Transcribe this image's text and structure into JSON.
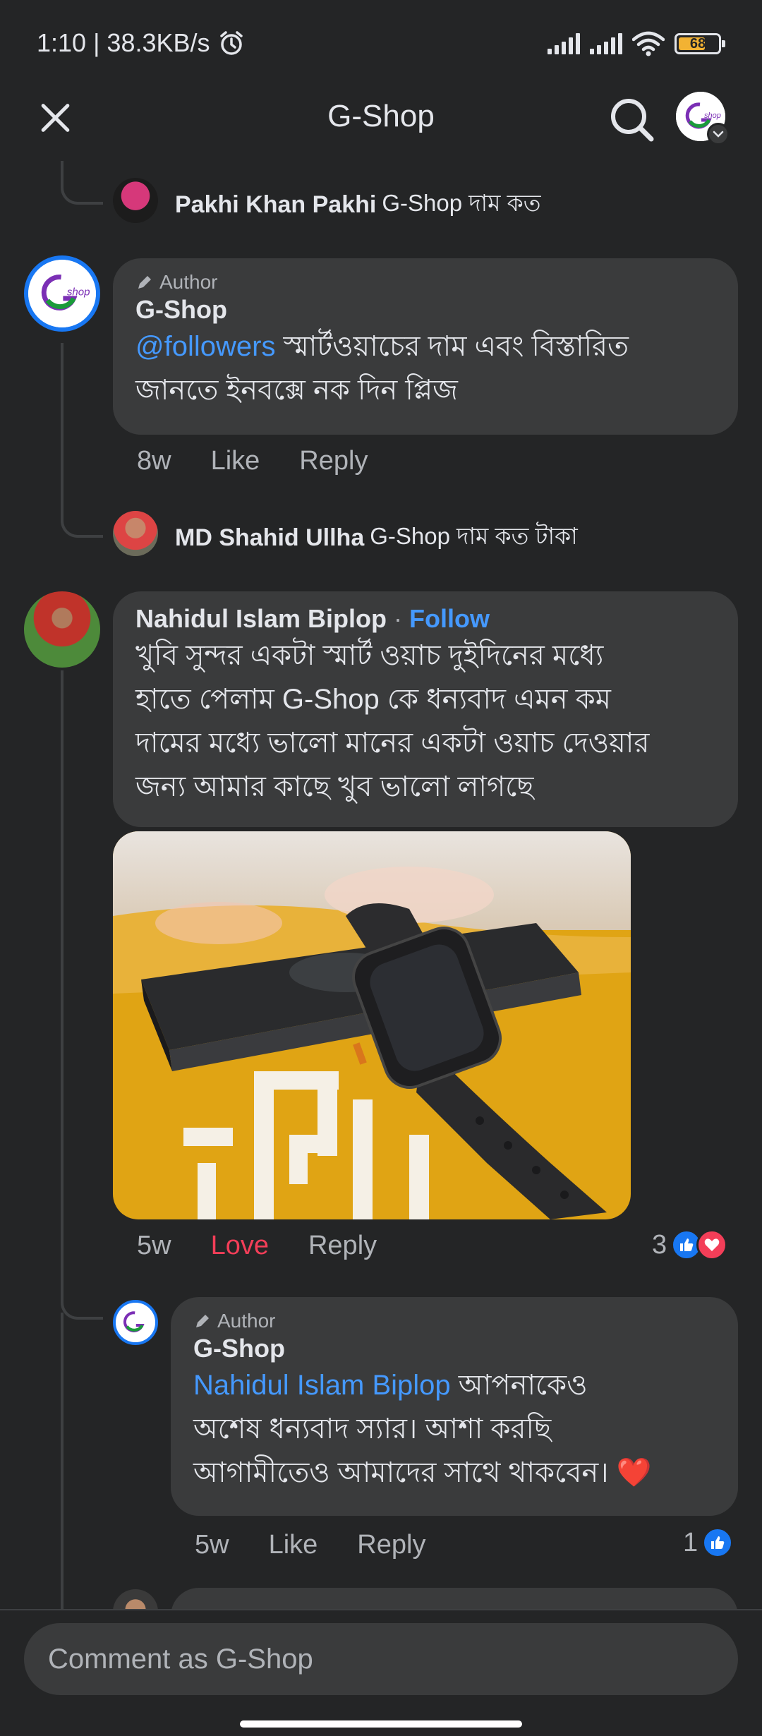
{
  "status": {
    "time_speed": "1:10 | 38.3KB/s",
    "battery": "68"
  },
  "header": {
    "title": "G-Shop",
    "logo_text": "shop"
  },
  "comments": [
    {
      "name": "Pakhi Khan Pakhi",
      "text": "G-Shop দাম কত"
    },
    {
      "author_label": "Author",
      "name": "G-Shop",
      "mention": "@followers",
      "text_line1": " স্মার্টওয়াচের দাম এবং বিস্তারিত",
      "text_line2": "জানতে ইনবক্সে নক দিন প্লিজ",
      "time": "8w",
      "like": "Like",
      "reply": "Reply"
    },
    {
      "name": "MD Shahid Ullha",
      "text": "G-Shop দাম কত টাকা"
    },
    {
      "name": "Nahidul Islam Biplop",
      "sep": " · ",
      "follow": "Follow",
      "text_lines": [
        "খুবি সুন্দর একটা স্মার্ট ওয়াচ দুইদিনের মধ্যে",
        "হাতে পেলাম G-Shop কে ধন্যবাদ এমন কম",
        "দামের মধ্যে ভালো মানের একটা ওয়াচ দেওয়ার",
        "জন্য আমার কাছে খুব ভালো লাগছে"
      ],
      "time": "5w",
      "love": "Love",
      "reply": "Reply",
      "reaction_count": "3"
    },
    {
      "author_label": "Author",
      "name": "G-Shop",
      "mention": "Nahidul Islam Biplop",
      "text_line1": " আপনাকেও",
      "text_line2": "অশেষ ধন্যবাদ স্যার। আশা করছি",
      "text_line3": "আগামীতেও আমাদের সাথে থাকবেন। ",
      "emoji": "❤️",
      "time": "5w",
      "like": "Like",
      "reply": "Reply",
      "reaction_count": "1"
    }
  ],
  "composer": {
    "placeholder": "Comment as G-Shop"
  },
  "colors": {
    "background": "#242526",
    "bubble": "#3a3b3c",
    "accent_blue": "#4599ff",
    "love_red": "#f33e58"
  }
}
